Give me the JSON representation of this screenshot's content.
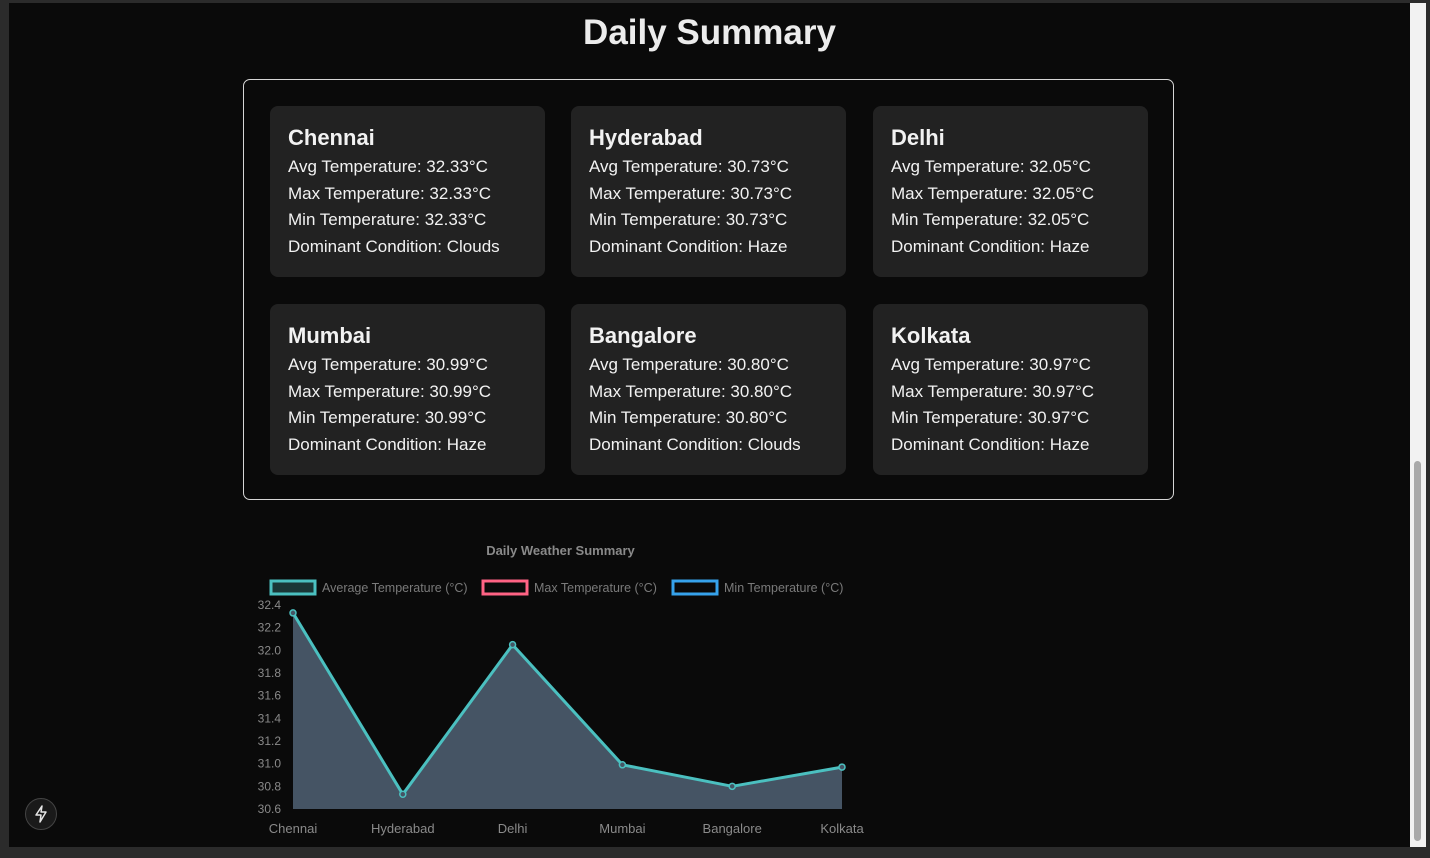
{
  "page": {
    "title": "Daily Summary"
  },
  "cities": [
    {
      "name": "Chennai",
      "avg": "Avg Temperature: 32.33°C",
      "max": "Max Temperature: 32.33°C",
      "min": "Min Temperature: 32.33°C",
      "condition": "Dominant Condition: Clouds"
    },
    {
      "name": "Hyderabad",
      "avg": "Avg Temperature: 30.73°C",
      "max": "Max Temperature: 30.73°C",
      "min": "Min Temperature: 30.73°C",
      "condition": "Dominant Condition: Haze"
    },
    {
      "name": "Delhi",
      "avg": "Avg Temperature: 32.05°C",
      "max": "Max Temperature: 32.05°C",
      "min": "Min Temperature: 32.05°C",
      "condition": "Dominant Condition: Haze"
    },
    {
      "name": "Mumbai",
      "avg": "Avg Temperature: 30.99°C",
      "max": "Max Temperature: 30.99°C",
      "min": "Min Temperature: 30.99°C",
      "condition": "Dominant Condition: Haze"
    },
    {
      "name": "Bangalore",
      "avg": "Avg Temperature: 30.80°C",
      "max": "Max Temperature: 30.80°C",
      "min": "Min Temperature: 30.80°C",
      "condition": "Dominant Condition: Clouds"
    },
    {
      "name": "Kolkata",
      "avg": "Avg Temperature: 30.97°C",
      "max": "Max Temperature: 30.97°C",
      "min": "Min Temperature: 30.97°C",
      "condition": "Dominant Condition: Haze"
    }
  ],
  "chart_data": {
    "type": "line",
    "title": "Daily Weather Summary",
    "categories": [
      "Chennai",
      "Hyderabad",
      "Delhi",
      "Mumbai",
      "Bangalore",
      "Kolkata"
    ],
    "series": [
      {
        "name": "Average Temperature (°C)",
        "values": [
          32.33,
          30.73,
          32.05,
          30.99,
          30.8,
          30.97
        ],
        "color": "#4bc0c0",
        "fill": "#455464",
        "visible": true
      },
      {
        "name": "Max Temperature (°C)",
        "values": [
          32.33,
          30.73,
          32.05,
          30.99,
          30.8,
          30.97
        ],
        "color": "#ff6384",
        "visible": false
      },
      {
        "name": "Min Temperature (°C)",
        "values": [
          32.33,
          30.73,
          32.05,
          30.99,
          30.8,
          30.97
        ],
        "color": "#36a2eb",
        "visible": false
      }
    ],
    "ylim": [
      30.6,
      32.4
    ],
    "yticks": [
      "32.4",
      "32.2",
      "32.0",
      "31.8",
      "31.6",
      "31.4",
      "31.2",
      "31.0",
      "30.8",
      "30.6"
    ],
    "legend": "top",
    "grid": false,
    "xlabel": "",
    "ylabel": ""
  },
  "colors": {
    "background": "#0a0a0a",
    "card": "#222222",
    "text": "#f2f2f2",
    "panel_border": "#d6d6d6"
  },
  "devtools": {
    "icon": "lightning-bolt-icon"
  }
}
